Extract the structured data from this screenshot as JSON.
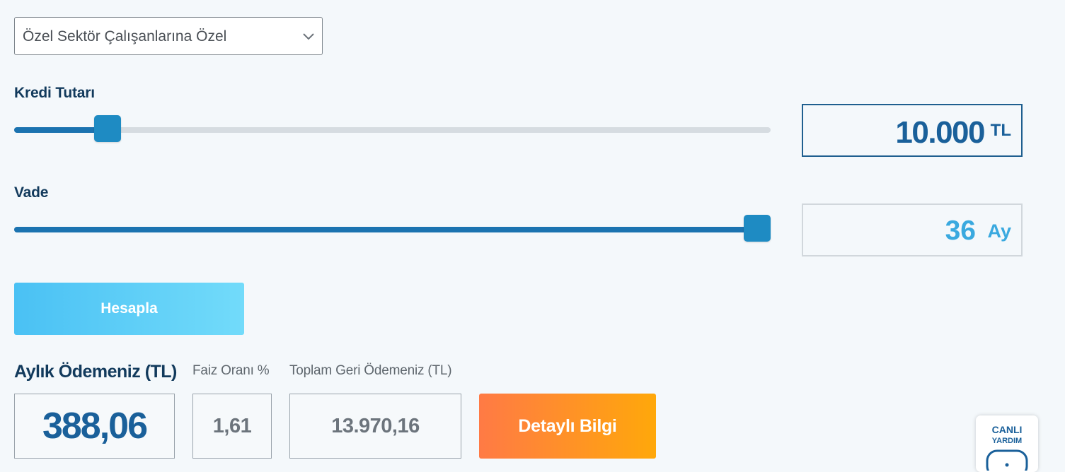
{
  "dropdown": {
    "selected": "Özel Sektör Çalışanlarına Özel"
  },
  "loan_amount": {
    "label": "Kredi Tutarı",
    "value": "10.000",
    "unit": "TL",
    "slider_fraction": 0.11
  },
  "term": {
    "label": "Vade",
    "value": "36",
    "unit": "Ay",
    "slider_fraction": 1.0
  },
  "calculate_button": {
    "label": "Hesapla"
  },
  "results": {
    "monthly_label": "Aylık Ödemeniz (TL)",
    "monthly_value": "388,06",
    "rate_label": "Faiz Oranı %",
    "rate_value": "1,61",
    "total_label": "Toplam Geri Ödemeniz (TL)",
    "total_value": "13.970,16"
  },
  "detail_button": {
    "label": "Detaylı Bilgi"
  },
  "live_help": {
    "line1": "CANLI",
    "line2": "YARDIM",
    "icon": "chat-bubble-icon"
  },
  "colors": {
    "primary_blue": "#1a609a",
    "slider_thumb": "#1e8bc3",
    "calc_gradient_start": "#4ac1f4",
    "calc_gradient_end": "#72dbfa",
    "detail_gradient_start": "#ff7a45",
    "detail_gradient_end": "#ffa80a",
    "term_value_color": "#3aa9df"
  }
}
